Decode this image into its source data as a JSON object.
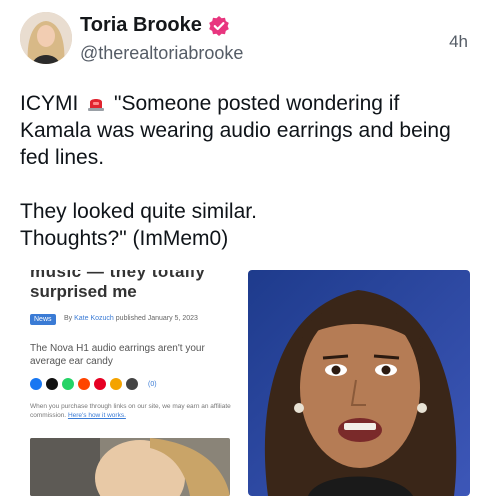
{
  "post": {
    "display_name": "Toria Brooke",
    "handle": "@therealtoriabrooke",
    "timestamp": "4h",
    "body_before": "ICYMI ",
    "body_after": " \"Someone posted wondering if Kamala was wearing audio earrings and being fed lines.\n\nThey looked quite similar.\nThoughts?\" (ImMem0)",
    "siren_icon": "police-light-icon"
  },
  "article": {
    "cut_text": "music — they totally",
    "title": "surprised me",
    "badge": "News",
    "byline_prefix": "By",
    "author": "Kate Kozuch",
    "byline_suffix": "published January 5, 2023",
    "subtitle": "The Nova H1 audio earrings aren't your average ear candy",
    "comment_count": "(0)",
    "disclaimer": "When you purchase through links on our site, we may earn an affiliate commission.",
    "disclaimer_link": "Here's how it works."
  },
  "colors": {
    "verified": "#e8367f",
    "accent": "#3a7bd5",
    "text": "#0f1419",
    "muted": "#555c66"
  }
}
